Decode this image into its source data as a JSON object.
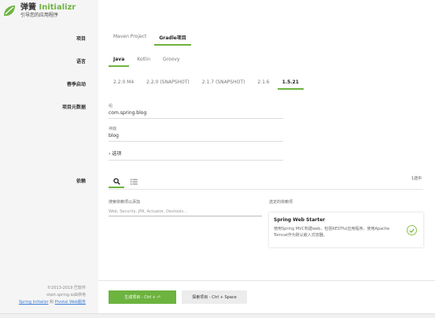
{
  "brand": {
    "title_prefix": "弹簧",
    "title_accent": "Initializr",
    "subtitle": "引导您的应用程序",
    "accent_color": "#6db33f"
  },
  "labels": {
    "project": "项目",
    "language": "语言",
    "spring_boot": "春季启动",
    "metadata": "项目元数据",
    "dependencies": "依赖"
  },
  "project_options": [
    "Maven Project",
    "Gradle项目"
  ],
  "project_selected": 1,
  "language_options": [
    "Java",
    "Kotlin",
    "Groovy"
  ],
  "language_selected": 0,
  "boot_options": [
    "2.2.0 M4",
    "2.2.0 (SNAPSHOT)",
    "2.1.7 (SNAPSHOT)",
    "2.1.6",
    "1.5.21"
  ],
  "boot_selected": 4,
  "metadata": {
    "group_label": "组",
    "group_value": "com.spring.blog",
    "artifact_label": "神器",
    "artifact_value": "blog",
    "options_toggle": "选项"
  },
  "dependencies": {
    "selected_count": "1选中",
    "search_label": "搜索依赖项以添加",
    "search_placeholder": "Web, Security, JPA, Actuator, Devtools...",
    "selected_label": "选定的依赖项",
    "items": [
      {
        "title": "Spring Web Starter",
        "description": "使用Spring MVC构建web，包括RESTful应用程序。使用Apache Tomcat作为默认嵌入式容器。"
      }
    ]
  },
  "footer": {
    "copyright": "©2013-2019 巴软件",
    "powered": "start.spring.io由供电",
    "link1": "Spring Initializr",
    "and": "和",
    "link2": "Pivotal Web服务"
  },
  "actions": {
    "generate": "生成项目 - Ctrl + ⏎",
    "explore": "探索项目 - Ctrl + Space"
  }
}
